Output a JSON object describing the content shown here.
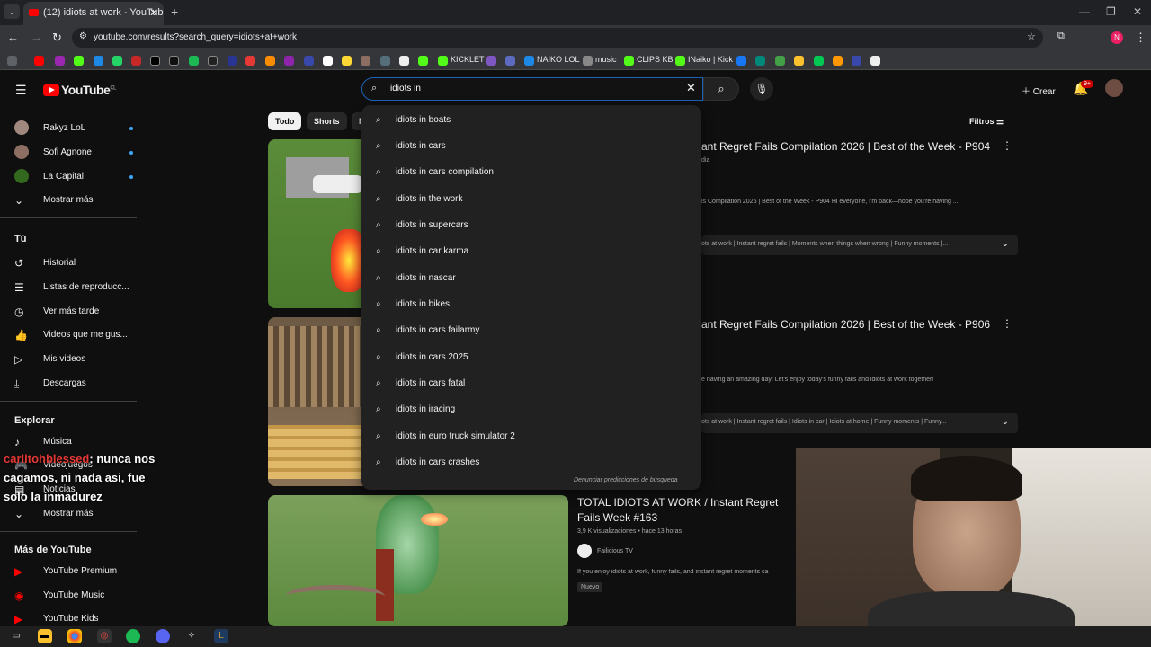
{
  "browser": {
    "tab_title": "(12) idiots at work - YouTube",
    "url": "youtube.com/results?search_query=idiots+at+work",
    "bookmarks": [
      "KICKLET",
      "NAIKO LOL",
      "music",
      "CLIPS KB",
      "INaiko | Kick"
    ]
  },
  "youtube": {
    "logo": "YouTube",
    "logo_region": "CL",
    "search_value": "idiots in",
    "create_label": "Crear",
    "notif_badge": "9+",
    "filters_label": "Filtros",
    "chips": [
      "Todo",
      "Shorts",
      "N"
    ]
  },
  "sidebar": {
    "subs": [
      {
        "name": "Rakyz LoL"
      },
      {
        "name": "Sofi Agnone"
      },
      {
        "name": "La Capital"
      }
    ],
    "show_more_1": "Mostrar más",
    "you_header": "Tú",
    "you_items": [
      "Historial",
      "Listas de reproducc...",
      "Ver más tarde",
      "Videos que me gus...",
      "Mis videos",
      "Descargas"
    ],
    "explore_header": "Explorar",
    "explore_items": [
      "Música",
      "Videojuegos",
      "Noticias"
    ],
    "show_more_2": "Mostrar más",
    "more_header": "Más de YouTube",
    "more_items": [
      "YouTube Premium",
      "YouTube Music",
      "YouTube Kids"
    ]
  },
  "chat": {
    "user": "carlitohblessed",
    "message": ": nunca nos cagamos, ni nada asi, fue solo la inmadurez"
  },
  "suggestions": [
    "idiots in boats",
    "idiots in cars",
    "idiots in cars compilation",
    "idiots in the work",
    "idiots in supercars",
    "idiots in car karma",
    "idiots in nascar",
    "idiots in bikes",
    "idiots in cars failarmy",
    "idiots in cars 2025",
    "idiots in cars fatal",
    "idiots in iracing",
    "idiots in euro truck simulator 2",
    "idiots in cars crashes"
  ],
  "report_text": "Denunciar predicciones de búsqueda",
  "videos": [
    {
      "title": "ant Regret Fails Compilation 2026 | Best of the Week - P904",
      "channel": "dia",
      "desc": "ls Compilation 2026 | Best of the Week - P904 Hi everyone, I'm back—hope you're having ...",
      "chapters": "ots at work | Instant regret fails | Moments when things when wrong | Funny moments |..."
    },
    {
      "title": "ant Regret Fails Compilation 2026 | Best of the Week - P906",
      "desc": "e having an amazing day! Let's enjoy today's funny fails and idiots at work together!",
      "chapters": "ots at work | Instant regret fails | Idiots in car | Idiots at home | Funny moments | Funny..."
    },
    {
      "title": "TOTAL IDIOTS AT WORK / Instant Regret Fails Week #163",
      "meta": "3,9 K visualizaciones • hace 13 horas",
      "channel": "Failicious TV",
      "desc": "If you enjoy idiots at work, funny fails, and instant regret moments ca",
      "badge": "Nuevo"
    }
  ]
}
